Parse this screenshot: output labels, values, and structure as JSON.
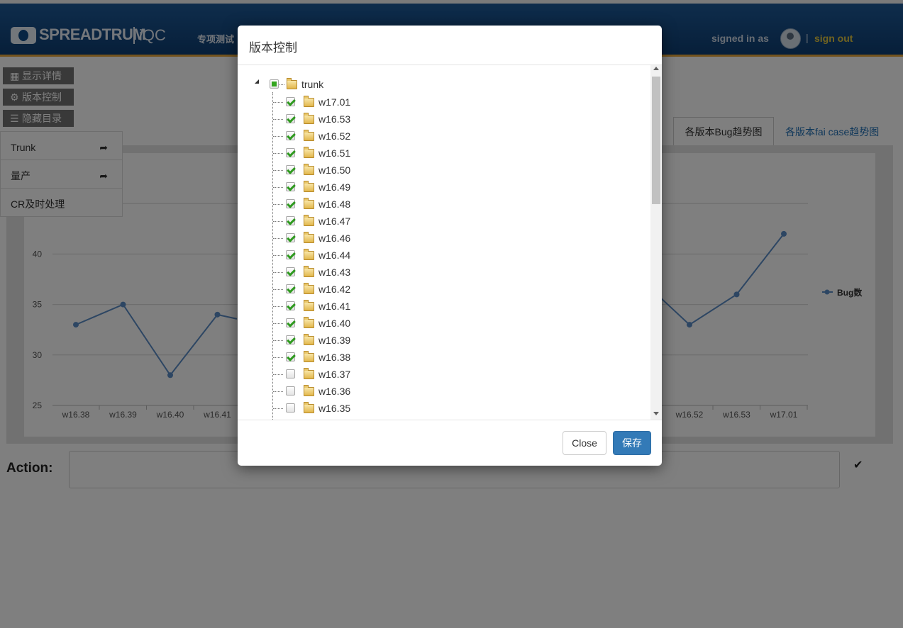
{
  "header": {
    "brand": "SPREADTRUM",
    "product": "iQC",
    "nav_item": "专项测试",
    "signed_in_label": "signed in as",
    "separator": "|",
    "sign_out": "sign out"
  },
  "side_buttons": [
    {
      "label": "显示详情",
      "icon": "grid-icon"
    },
    {
      "label": "版本控制",
      "icon": "gear-icon"
    },
    {
      "label": "隐藏目录",
      "icon": "list-icon"
    }
  ],
  "side_menu": [
    {
      "label": "Trunk",
      "arrow": "share-arrow-icon"
    },
    {
      "label": "量产",
      "arrow": "share-arrow-icon"
    },
    {
      "label": "CR及时处理",
      "arrow": ""
    }
  ],
  "tabs": [
    {
      "label": "各版本Bug趋势图",
      "active": true
    },
    {
      "label": "各版本fai case趋势图",
      "active": false
    }
  ],
  "chart_data": {
    "type": "line",
    "categories": [
      "w16.38",
      "w16.39",
      "w16.40",
      "w16.41",
      "w16.52",
      "w16.53",
      "w17.01"
    ],
    "series": [
      {
        "name": "Bug数",
        "values": [
          33,
          35,
          28,
          34,
          33,
          36,
          42
        ]
      }
    ],
    "yticks": [
      "25",
      "30",
      "35",
      "40",
      "45"
    ],
    "ylim": [
      25,
      50
    ],
    "legend_position": "right",
    "color": "#5b8cc6"
  },
  "action": {
    "label": "Action:",
    "value": ""
  },
  "modal": {
    "title": "版本控制",
    "root": {
      "label": "trunk",
      "state": "partial"
    },
    "items": [
      {
        "label": "w17.01",
        "checked": true
      },
      {
        "label": "w16.53",
        "checked": true
      },
      {
        "label": "w16.52",
        "checked": true
      },
      {
        "label": "w16.51",
        "checked": true
      },
      {
        "label": "w16.50",
        "checked": true
      },
      {
        "label": "w16.49",
        "checked": true
      },
      {
        "label": "w16.48",
        "checked": true
      },
      {
        "label": "w16.47",
        "checked": true
      },
      {
        "label": "w16.46",
        "checked": true
      },
      {
        "label": "w16.44",
        "checked": true
      },
      {
        "label": "w16.43",
        "checked": true
      },
      {
        "label": "w16.42",
        "checked": true
      },
      {
        "label": "w16.41",
        "checked": true
      },
      {
        "label": "w16.40",
        "checked": true
      },
      {
        "label": "w16.39",
        "checked": true
      },
      {
        "label": "w16.38",
        "checked": true
      },
      {
        "label": "w16.37",
        "checked": false
      },
      {
        "label": "w16.36",
        "checked": false
      },
      {
        "label": "w16.35",
        "checked": false
      }
    ],
    "close_label": "Close",
    "save_label": "保存"
  }
}
